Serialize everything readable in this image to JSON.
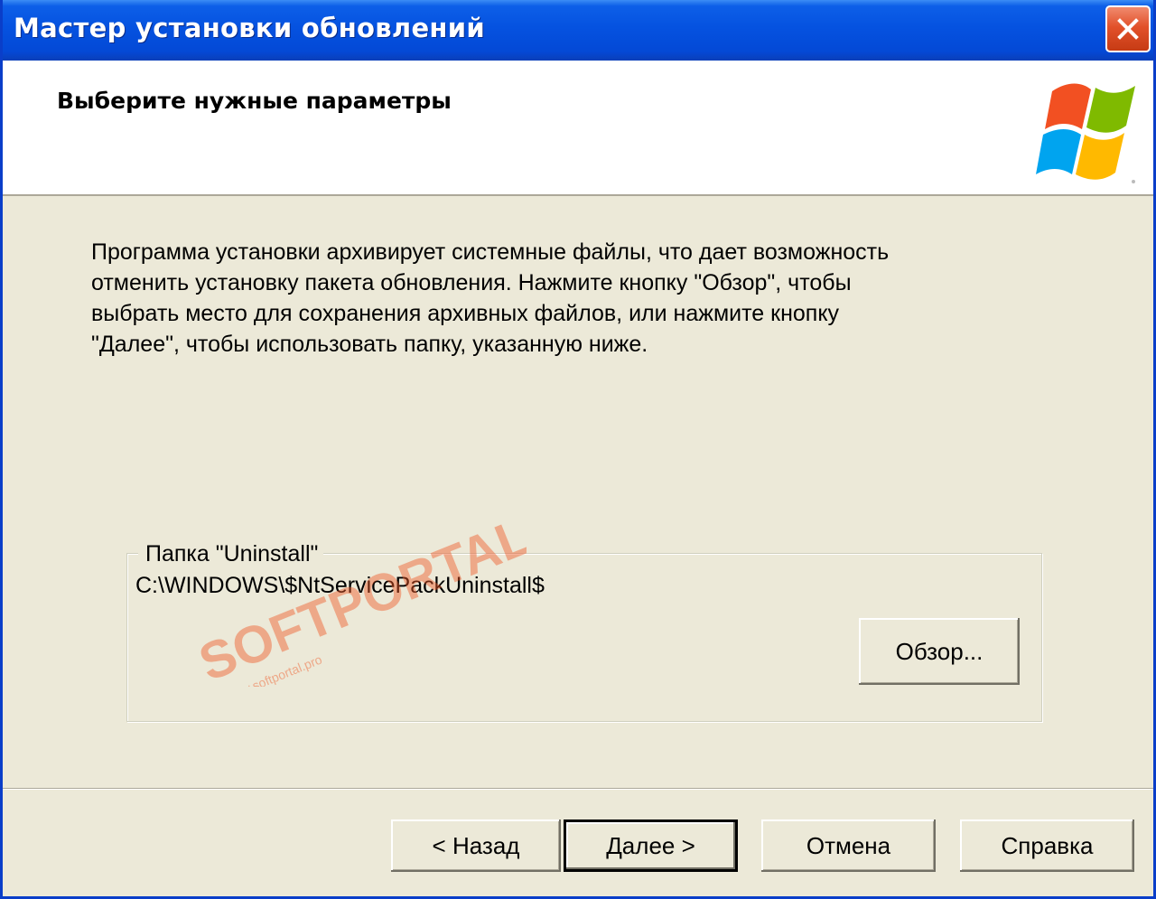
{
  "window": {
    "title": "Мастер установки обновлений",
    "close_icon": "close-icon"
  },
  "header": {
    "title": "Выберите нужные параметры",
    "logo_icon": "windows-logo-icon"
  },
  "body": {
    "description": "Программа установки архивирует системные файлы, что дает возможность\nотменить установку пакета обновления.  Нажмите кнопку \"Обзор\", чтобы\nвыбрать место для сохранения архивных файлов, или нажмите кнопку\n\"Далее\", чтобы использовать папку, указанную ниже.",
    "folder_group": {
      "legend": "Папка \"Uninstall\"",
      "path": "C:\\WINDOWS\\$NtServicePackUninstall$",
      "browse_label": "Обзор..."
    }
  },
  "footer": {
    "back_label": "< Назад",
    "next_label": "Далее >",
    "cancel_label": "Отмена",
    "help_label": "Справка"
  },
  "watermark": {
    "brand": "SOFTPORTAL",
    "url": "www.softportal.pro"
  },
  "colors": {
    "title_bar": "#0552e0",
    "dialog_background": "#ece9d8",
    "close_button": "#e2512a",
    "watermark": "#f05a28"
  }
}
